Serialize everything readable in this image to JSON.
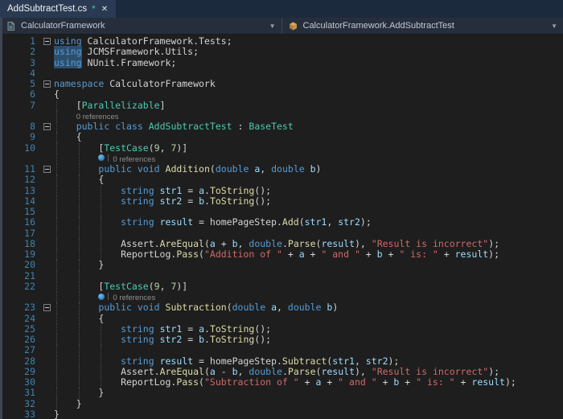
{
  "colors": {
    "editor_background": "#1e1e1e",
    "keyword": "#569cd6",
    "type": "#4ec9b0",
    "method": "#dcdcaa",
    "variable": "#9cdcfe",
    "string": "#d16969",
    "number": "#b5cea8",
    "line_number": "#3f83b0",
    "codelens_text": "#8f8f8f",
    "word_highlight": "#2d4f6e",
    "tab_strip": "#1c2a3e"
  },
  "tab_bar": {
    "active_tab": {
      "title": "AddSubtractTest.cs",
      "modified_indicator": "*",
      "close_label": "✕"
    }
  },
  "breadcrumb": {
    "project": {
      "label": "CalculatorFramework",
      "dropdown_icon": "▼"
    },
    "type": {
      "label": "CalculatorFramework.AddSubtractTest",
      "dropdown_icon": "▼"
    }
  },
  "editor": {
    "lines": [
      {
        "n": 1,
        "fold": true,
        "tok": [
          [
            "k",
            "using"
          ],
          [
            "p",
            " CalculatorFramework.Tests;"
          ]
        ]
      },
      {
        "n": 2,
        "tok": [
          [
            "kh",
            "using"
          ],
          [
            "p",
            " JCMSFramework.Utils;"
          ]
        ]
      },
      {
        "n": 3,
        "tok": [
          [
            "kh",
            "using"
          ],
          [
            "p",
            " NUnit.Framework;"
          ]
        ]
      },
      {
        "n": 4,
        "tok": []
      },
      {
        "n": 5,
        "fold": true,
        "tok": [
          [
            "k",
            "namespace"
          ],
          [
            "p",
            " CalculatorFramework"
          ]
        ]
      },
      {
        "n": 6,
        "tok": [
          [
            "p",
            "{"
          ]
        ]
      },
      {
        "n": 7,
        "tok": [
          [
            "p",
            "    ["
          ],
          [
            "t",
            "Parallelizable"
          ],
          [
            "p",
            "]"
          ]
        ]
      },
      {
        "cl": true,
        "indent": 4,
        "refs": "0 references"
      },
      {
        "n": 8,
        "fold": true,
        "tok": [
          [
            "p",
            "    "
          ],
          [
            "k",
            "public"
          ],
          [
            "p",
            " "
          ],
          [
            "k",
            "class"
          ],
          [
            "p",
            " "
          ],
          [
            "t",
            "AddSubtractTest"
          ],
          [
            "p",
            " : "
          ],
          [
            "t",
            "BaseTest"
          ]
        ]
      },
      {
        "n": 9,
        "tok": [
          [
            "p",
            "    {"
          ]
        ]
      },
      {
        "n": 10,
        "tok": [
          [
            "p",
            "        ["
          ],
          [
            "t",
            "TestCase"
          ],
          [
            "p",
            "("
          ],
          [
            "num",
            "9"
          ],
          [
            "p",
            ", "
          ],
          [
            "num",
            "7"
          ],
          [
            "p",
            ")]"
          ]
        ]
      },
      {
        "cl": true,
        "indent": 8,
        "icon": true,
        "refs": "0 references"
      },
      {
        "n": 11,
        "fold": true,
        "tok": [
          [
            "p",
            "        "
          ],
          [
            "k",
            "public"
          ],
          [
            "p",
            " "
          ],
          [
            "k",
            "void"
          ],
          [
            "p",
            " "
          ],
          [
            "m",
            "Addition"
          ],
          [
            "p",
            "("
          ],
          [
            "k",
            "double"
          ],
          [
            "p",
            " "
          ],
          [
            "v",
            "a"
          ],
          [
            "p",
            ", "
          ],
          [
            "k",
            "double"
          ],
          [
            "p",
            " "
          ],
          [
            "v",
            "b"
          ],
          [
            "p",
            ")"
          ]
        ]
      },
      {
        "n": 12,
        "tok": [
          [
            "p",
            "        {"
          ]
        ]
      },
      {
        "n": 13,
        "tok": [
          [
            "p",
            "            "
          ],
          [
            "k",
            "string"
          ],
          [
            "p",
            " "
          ],
          [
            "v",
            "str1"
          ],
          [
            "p",
            " = "
          ],
          [
            "v",
            "a"
          ],
          [
            "p",
            "."
          ],
          [
            "m",
            "ToString"
          ],
          [
            "p",
            "();"
          ]
        ]
      },
      {
        "n": 14,
        "tok": [
          [
            "p",
            "            "
          ],
          [
            "k",
            "string"
          ],
          [
            "p",
            " "
          ],
          [
            "v",
            "str2"
          ],
          [
            "p",
            " = "
          ],
          [
            "v",
            "b"
          ],
          [
            "p",
            "."
          ],
          [
            "m",
            "ToString"
          ],
          [
            "p",
            "();"
          ]
        ]
      },
      {
        "n": 15,
        "tok": []
      },
      {
        "n": 16,
        "tok": [
          [
            "p",
            "            "
          ],
          [
            "k",
            "string"
          ],
          [
            "p",
            " "
          ],
          [
            "v",
            "result"
          ],
          [
            "p",
            " = homePageStep."
          ],
          [
            "m",
            "Add"
          ],
          [
            "p",
            "("
          ],
          [
            "v",
            "str1"
          ],
          [
            "p",
            ", "
          ],
          [
            "v",
            "str2"
          ],
          [
            "p",
            ");"
          ]
        ]
      },
      {
        "n": 17,
        "tok": []
      },
      {
        "n": 18,
        "tok": [
          [
            "p",
            "            Assert."
          ],
          [
            "m",
            "AreEqual"
          ],
          [
            "p",
            "("
          ],
          [
            "v",
            "a"
          ],
          [
            "p",
            " + "
          ],
          [
            "v",
            "b"
          ],
          [
            "p",
            ", "
          ],
          [
            "k",
            "double"
          ],
          [
            "p",
            "."
          ],
          [
            "m",
            "Parse"
          ],
          [
            "p",
            "("
          ],
          [
            "v",
            "result"
          ],
          [
            "p",
            "), "
          ],
          [
            "s",
            "\"Result is incorrect\""
          ],
          [
            "p",
            ");"
          ]
        ]
      },
      {
        "n": 19,
        "tok": [
          [
            "p",
            "            ReportLog."
          ],
          [
            "m",
            "Pass"
          ],
          [
            "p",
            "("
          ],
          [
            "s",
            "\"Addition of \""
          ],
          [
            "p",
            " + "
          ],
          [
            "v",
            "a"
          ],
          [
            "p",
            " + "
          ],
          [
            "s",
            "\" and \""
          ],
          [
            "p",
            " + "
          ],
          [
            "v",
            "b"
          ],
          [
            "p",
            " + "
          ],
          [
            "s",
            "\" is: \""
          ],
          [
            "p",
            " + "
          ],
          [
            "v",
            "result"
          ],
          [
            "p",
            ");"
          ]
        ]
      },
      {
        "n": 20,
        "tok": [
          [
            "p",
            "        }"
          ]
        ]
      },
      {
        "n": 21,
        "tok": []
      },
      {
        "n": 22,
        "tok": [
          [
            "p",
            "        ["
          ],
          [
            "t",
            "TestCase"
          ],
          [
            "p",
            "("
          ],
          [
            "num",
            "9"
          ],
          [
            "p",
            ", "
          ],
          [
            "num",
            "7"
          ],
          [
            "p",
            ")]"
          ]
        ]
      },
      {
        "cl": true,
        "indent": 8,
        "icon": true,
        "refs": "0 references"
      },
      {
        "n": 23,
        "fold": true,
        "tok": [
          [
            "p",
            "        "
          ],
          [
            "k",
            "public"
          ],
          [
            "p",
            " "
          ],
          [
            "k",
            "void"
          ],
          [
            "p",
            " "
          ],
          [
            "m",
            "Subtraction"
          ],
          [
            "p",
            "("
          ],
          [
            "k",
            "double"
          ],
          [
            "p",
            " "
          ],
          [
            "v",
            "a"
          ],
          [
            "p",
            ", "
          ],
          [
            "k",
            "double"
          ],
          [
            "p",
            " "
          ],
          [
            "v",
            "b"
          ],
          [
            "p",
            ")"
          ]
        ]
      },
      {
        "n": 24,
        "tok": [
          [
            "p",
            "        {"
          ]
        ]
      },
      {
        "n": 25,
        "tok": [
          [
            "p",
            "            "
          ],
          [
            "k",
            "string"
          ],
          [
            "p",
            " "
          ],
          [
            "v",
            "str1"
          ],
          [
            "p",
            " = "
          ],
          [
            "v",
            "a"
          ],
          [
            "p",
            "."
          ],
          [
            "m",
            "ToString"
          ],
          [
            "p",
            "();"
          ]
        ]
      },
      {
        "n": 26,
        "tok": [
          [
            "p",
            "            "
          ],
          [
            "k",
            "string"
          ],
          [
            "p",
            " "
          ],
          [
            "v",
            "str2"
          ],
          [
            "p",
            " = "
          ],
          [
            "v",
            "b"
          ],
          [
            "p",
            "."
          ],
          [
            "m",
            "ToString"
          ],
          [
            "p",
            "();"
          ]
        ]
      },
      {
        "n": 27,
        "tok": []
      },
      {
        "n": 28,
        "tok": [
          [
            "p",
            "            "
          ],
          [
            "k",
            "string"
          ],
          [
            "p",
            " "
          ],
          [
            "v",
            "result"
          ],
          [
            "p",
            " = homePageStep."
          ],
          [
            "m",
            "Subtract"
          ],
          [
            "p",
            "("
          ],
          [
            "v",
            "str1"
          ],
          [
            "p",
            ", "
          ],
          [
            "v",
            "str2"
          ],
          [
            "p",
            ");"
          ]
        ]
      },
      {
        "n": 29,
        "tok": [
          [
            "p",
            "            Assert."
          ],
          [
            "m",
            "AreEqual"
          ],
          [
            "p",
            "("
          ],
          [
            "v",
            "a"
          ],
          [
            "p",
            " - "
          ],
          [
            "v",
            "b"
          ],
          [
            "p",
            ", "
          ],
          [
            "k",
            "double"
          ],
          [
            "p",
            "."
          ],
          [
            "m",
            "Parse"
          ],
          [
            "p",
            "("
          ],
          [
            "v",
            "result"
          ],
          [
            "p",
            "), "
          ],
          [
            "s",
            "\"Result is incorrect\""
          ],
          [
            "p",
            ");"
          ]
        ]
      },
      {
        "n": 30,
        "tok": [
          [
            "p",
            "            ReportLog."
          ],
          [
            "m",
            "Pass"
          ],
          [
            "p",
            "("
          ],
          [
            "s",
            "\"Subtraction of \""
          ],
          [
            "p",
            " + "
          ],
          [
            "v",
            "a"
          ],
          [
            "p",
            " + "
          ],
          [
            "s",
            "\" and \""
          ],
          [
            "p",
            " + "
          ],
          [
            "v",
            "b"
          ],
          [
            "p",
            " + "
          ],
          [
            "s",
            "\" is: \""
          ],
          [
            "p",
            " + "
          ],
          [
            "v",
            "result"
          ],
          [
            "p",
            ");"
          ]
        ]
      },
      {
        "n": 31,
        "tok": [
          [
            "p",
            "        }"
          ]
        ]
      },
      {
        "n": 32,
        "tok": [
          [
            "p",
            "    }"
          ]
        ]
      },
      {
        "n": 33,
        "tok": [
          [
            "p",
            "}"
          ]
        ]
      }
    ]
  }
}
